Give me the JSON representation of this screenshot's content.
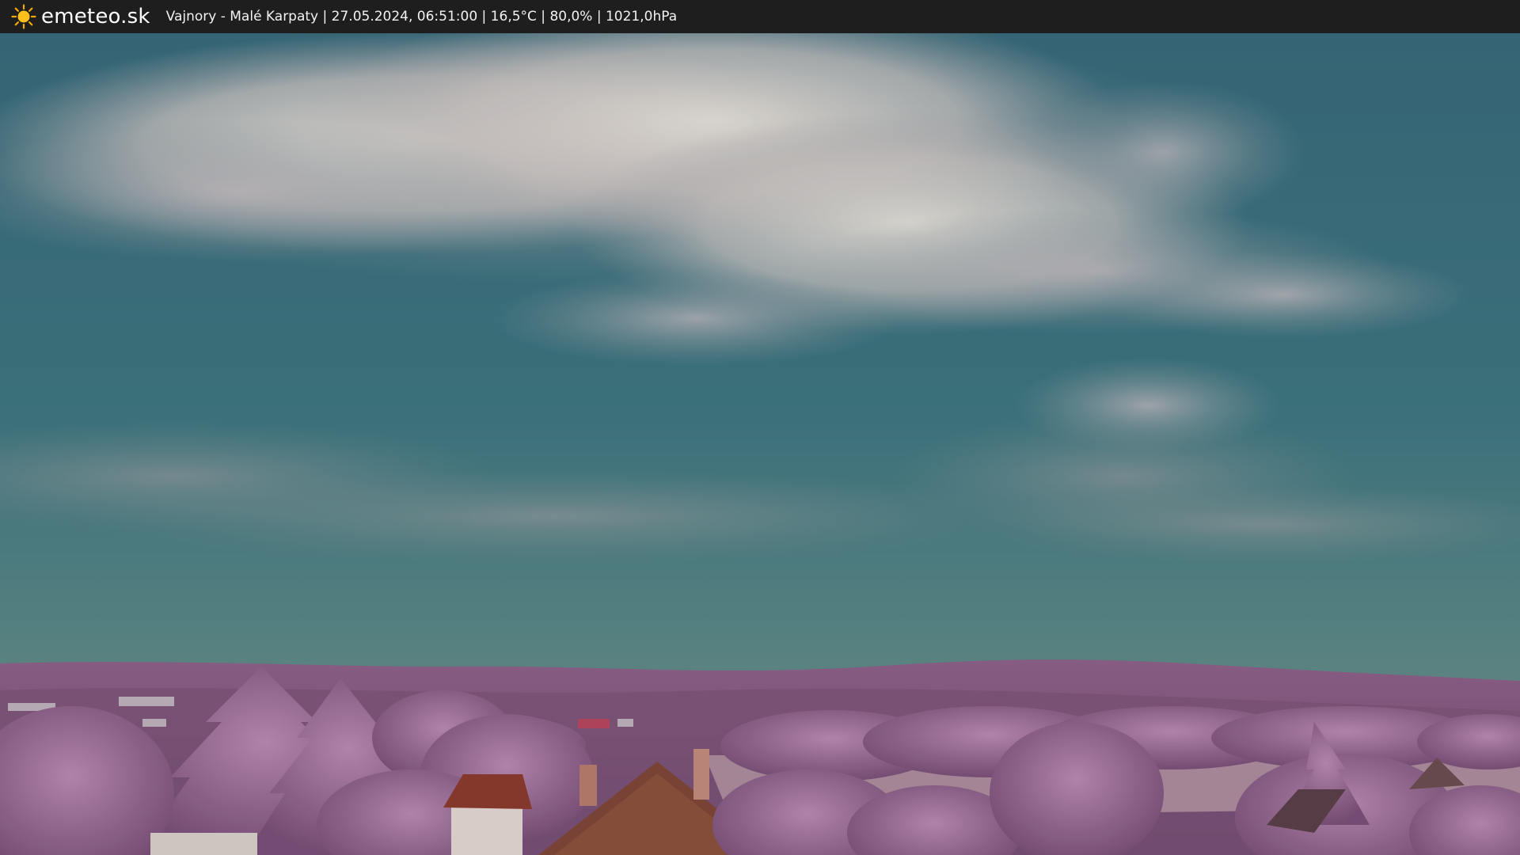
{
  "header": {
    "brand": "emeteo.sk",
    "caption": "Vajnory - Malé Karpaty | 27.05.2024, 06:51:00 | 16,5°C | 80,0% | 1021,0hPa",
    "logo_icon": "sun-icon"
  },
  "colors": {
    "bar_background": "#1e1e1e",
    "sky_top": "#3c6f7c",
    "sky_horizon": "#6f8f8a",
    "cloud": "#d8d3cf",
    "foliage": "#a0729e",
    "hills": "#8a5c86",
    "roof": "#8b3a2e"
  }
}
